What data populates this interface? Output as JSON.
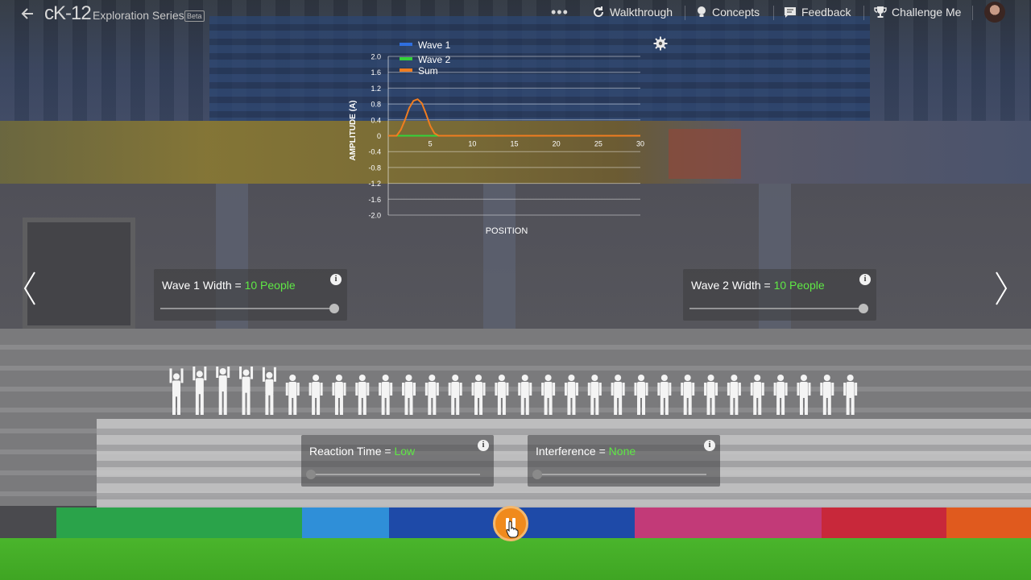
{
  "header": {
    "logo": "cK-12",
    "series": "Exploration Series",
    "badge": "Beta",
    "more_label": "•••",
    "nav": [
      {
        "label": "Walkthrough",
        "icon": "refresh-icon"
      },
      {
        "label": "Concepts",
        "icon": "lightbulb-icon"
      },
      {
        "label": "Feedback",
        "icon": "feedback-icon"
      },
      {
        "label": "Challenge Me",
        "icon": "trophy-icon"
      }
    ]
  },
  "chart_data": {
    "type": "line",
    "xlabel": "POSITION",
    "ylabel": "AMPLITUDE (A)",
    "xlim": [
      0,
      30
    ],
    "ylim": [
      -2.0,
      2.0
    ],
    "x_ticks": [
      "5",
      "10",
      "15",
      "20",
      "25",
      "30"
    ],
    "y_ticks": [
      "2.0",
      "1.6",
      "1.2",
      "0.8",
      "0.4",
      "0",
      "-0.4",
      "-0.8",
      "-1.2",
      "-1.6",
      "-2.0"
    ],
    "legend": [
      "Wave 1",
      "Wave 2",
      "Sum"
    ],
    "legend_colors": [
      "#2f6fe0",
      "#34d33a",
      "#f07d20"
    ],
    "series": [
      {
        "name": "Wave 1",
        "color": "#2f6fe0",
        "x": [
          0,
          30
        ],
        "y": [
          0,
          0
        ]
      },
      {
        "name": "Wave 2",
        "color": "#34d33a",
        "x": [
          0,
          30
        ],
        "y": [
          0,
          0
        ]
      },
      {
        "name": "Sum",
        "color": "#f07d20",
        "x": [
          0,
          1,
          1.5,
          2,
          2.5,
          3,
          3.5,
          4,
          4.5,
          5,
          5.5,
          6,
          7,
          30
        ],
        "y": [
          0,
          0,
          0.15,
          0.4,
          0.7,
          0.88,
          0.92,
          0.82,
          0.55,
          0.25,
          0.06,
          0,
          0,
          0
        ]
      }
    ],
    "grid": true
  },
  "controls": {
    "wave1": {
      "label": "Wave 1 Width = ",
      "value": "10 People",
      "level": 1.0
    },
    "wave2": {
      "label": "Wave 2 Width = ",
      "value": "10 People",
      "level": 1.0
    },
    "reaction": {
      "label": "Reaction Time = ",
      "value": "Low",
      "level": 0.0
    },
    "interference": {
      "label": "Interference = ",
      "value": "None",
      "level": 0.0
    },
    "info_label": "i"
  },
  "crowd": {
    "count": 30,
    "raised_heights": [
      0.2,
      0.6,
      1.0,
      0.8,
      0.4
    ]
  },
  "colors": {
    "accent_green": "#5fe845",
    "play_orange": "#f08a1c"
  }
}
